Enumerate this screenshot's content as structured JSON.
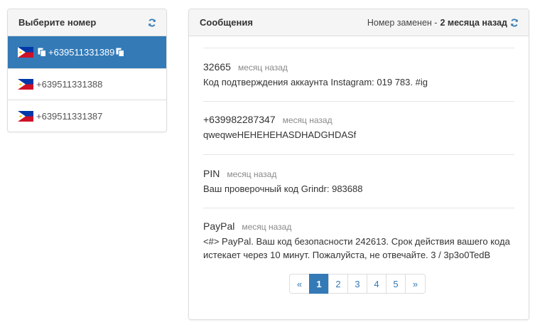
{
  "left_panel": {
    "title": "Выберите номер",
    "numbers": [
      {
        "label": "+639511331389",
        "active": true
      },
      {
        "label": "+639511331388",
        "active": false
      },
      {
        "label": "+639511331387",
        "active": false
      }
    ]
  },
  "right_panel": {
    "title": "Сообщения",
    "replaced_prefix": "Номер заменен -",
    "replaced_time": "2 месяца назад",
    "messages": [
      {
        "sender": "32665",
        "time": "месяц назад",
        "text": "Код подтверждения аккаунта Instagram: 019 783. #ig"
      },
      {
        "sender": "+639982287347",
        "time": "месяц назад",
        "text": "qweqweHEHEHEHASDHADGHDASf"
      },
      {
        "sender": "PIN",
        "time": "месяц назад",
        "text": "Ваш проверочный код Grindr: 983688"
      },
      {
        "sender": "PayPal",
        "time": "месяц назад",
        "text_line1": "<#> PayPal. Ваш код безопасности 242613. Срок действия вашего кода",
        "text_line2": "истекает через 10 минут. Пожалуйста, не отвечайте. 3 / 3p3o0TedB"
      }
    ],
    "pagination": {
      "prev": "«",
      "pages": [
        "1",
        "2",
        "3",
        "4",
        "5"
      ],
      "current": "1",
      "next": "»"
    }
  },
  "icons": {
    "flag": "philippines-flag-icon",
    "copy": "copy-icon",
    "refresh": "refresh-icon"
  },
  "colors": {
    "accent": "#337ab7",
    "panel_heading_bg": "#f5f5f5",
    "border": "#dddddd",
    "muted_text": "#8a8a8a"
  }
}
